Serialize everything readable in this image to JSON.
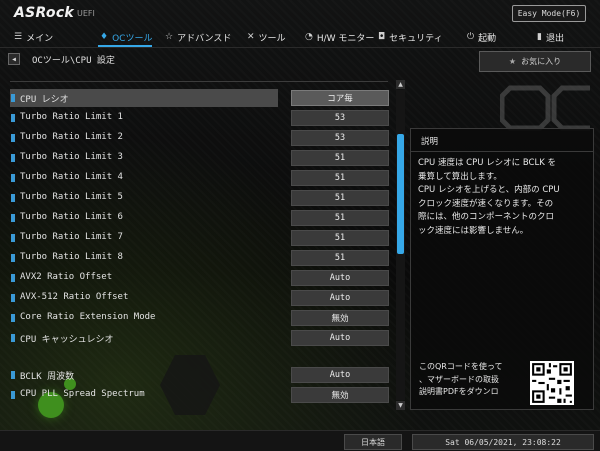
{
  "header": {
    "logo": "ASRock",
    "subtitle": "UEFI",
    "easy_mode": "Easy Mode(F6)"
  },
  "nav": {
    "items": [
      {
        "label": "メイン",
        "icon": "menu-icon"
      },
      {
        "label": "OCツール",
        "icon": "flame-icon",
        "active": true
      },
      {
        "label": "アドバンスド",
        "icon": "star-icon"
      },
      {
        "label": "ツール",
        "icon": "tools-icon"
      },
      {
        "label": "H/W モニター",
        "icon": "monitor-icon"
      },
      {
        "label": "セキュリティ",
        "icon": "shield-icon"
      },
      {
        "label": "起動",
        "icon": "power-icon"
      },
      {
        "label": "退出",
        "icon": "exit-icon"
      }
    ]
  },
  "breadcrumb": "OCツール\\CPU 設定",
  "favorite": "お気に入り",
  "settings": [
    {
      "label": "CPU  レシオ",
      "value": "コア毎",
      "selected": true
    },
    {
      "label": "Turbo Ratio Limit 1",
      "value": "53"
    },
    {
      "label": "Turbo Ratio Limit 2",
      "value": "53"
    },
    {
      "label": "Turbo Ratio Limit 3",
      "value": "51"
    },
    {
      "label": "Turbo Ratio Limit 4",
      "value": "51"
    },
    {
      "label": "Turbo Ratio Limit 5",
      "value": "51"
    },
    {
      "label": "Turbo Ratio Limit 6",
      "value": "51"
    },
    {
      "label": "Turbo Ratio Limit 7",
      "value": "51"
    },
    {
      "label": "Turbo Ratio Limit 8",
      "value": "51"
    },
    {
      "label": "AVX2 Ratio Offset",
      "value": "Auto"
    },
    {
      "label": "AVX-512 Ratio Offset",
      "value": "Auto"
    },
    {
      "label": "Core Ratio Extension Mode",
      "value": "無効"
    },
    {
      "label": "CPU  キャッシュレシオ",
      "value": "Auto"
    },
    {
      "label": "BCLK 周波数",
      "value": "Auto"
    },
    {
      "label": "CPU     PLL Spread Spectrum",
      "value": "無効"
    }
  ],
  "description": {
    "title": "説明",
    "text": "CPU 速度は CPU レシオに BCLK を\n乗算して算出します。\nCPU レシオを上げると、内部の CPU\nクロック速度が速くなります。その\n際には、他のコンポーネントのクロ\nック速度には影響しません。",
    "qr_text": "このQRコードを使って\n、マザーボードの取扱\n説明書PDFをダウンロ"
  },
  "footer": {
    "language": "日本語",
    "datetime": "Sat 06/05/2021, 23:08:22"
  },
  "colors": {
    "accent": "#36a8e8",
    "selected_row": "#4a4a4a",
    "value_box": "#3a3a3a"
  }
}
